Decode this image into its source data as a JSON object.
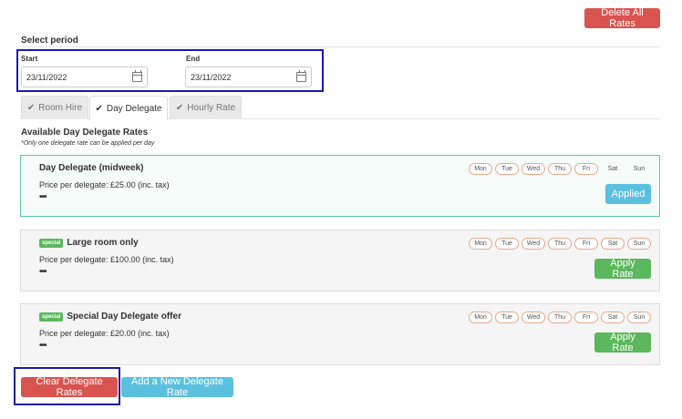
{
  "header": {
    "delete_all_label": "Delete All Rates"
  },
  "period": {
    "title": "Select period",
    "start_label": "Start",
    "start_value": "23/11/2022",
    "end_label": "End",
    "end_value": "23/11/2022"
  },
  "tabs": [
    {
      "label": "Room Hire",
      "active": false
    },
    {
      "label": "Day Delegate",
      "active": true
    },
    {
      "label": "Hourly Rate",
      "active": false
    }
  ],
  "available": {
    "title": "Available Day Delegate Rates",
    "note": "*Only one delegate rate can be applied per day"
  },
  "days": [
    "Mon",
    "Tue",
    "Wed",
    "Thu",
    "Fri",
    "Sat",
    "Sun"
  ],
  "rates": [
    {
      "name": "Day Delegate (midweek)",
      "special": false,
      "price": "Price per delegate: £25.00 (inc. tax)",
      "dots": "•••",
      "active_days": [
        true,
        true,
        true,
        true,
        true,
        false,
        false
      ],
      "button": "Applied",
      "applied": true
    },
    {
      "name": "Large room only",
      "special": true,
      "badge": "special",
      "price": "Price per delegate: £100.00 (inc. tax)",
      "dots": "•••",
      "active_days": [
        true,
        true,
        true,
        true,
        true,
        true,
        true
      ],
      "button": "Apply Rate",
      "applied": false
    },
    {
      "name": "Special Day Delegate offer",
      "special": true,
      "badge": "special",
      "price": "Price per delegate: £20.00 (inc. tax)",
      "dots": "•••",
      "active_days": [
        true,
        true,
        true,
        true,
        true,
        true,
        true
      ],
      "button": "Apply Rate",
      "applied": false
    }
  ],
  "footer": {
    "clear_label": "Clear Delegate Rates",
    "add_label": "Add a New Delegate Rate"
  },
  "colors": {
    "danger": "#d9534f",
    "success": "#5cb85c",
    "info": "#5bc0de",
    "highlight_box": "#1a1aa8"
  }
}
